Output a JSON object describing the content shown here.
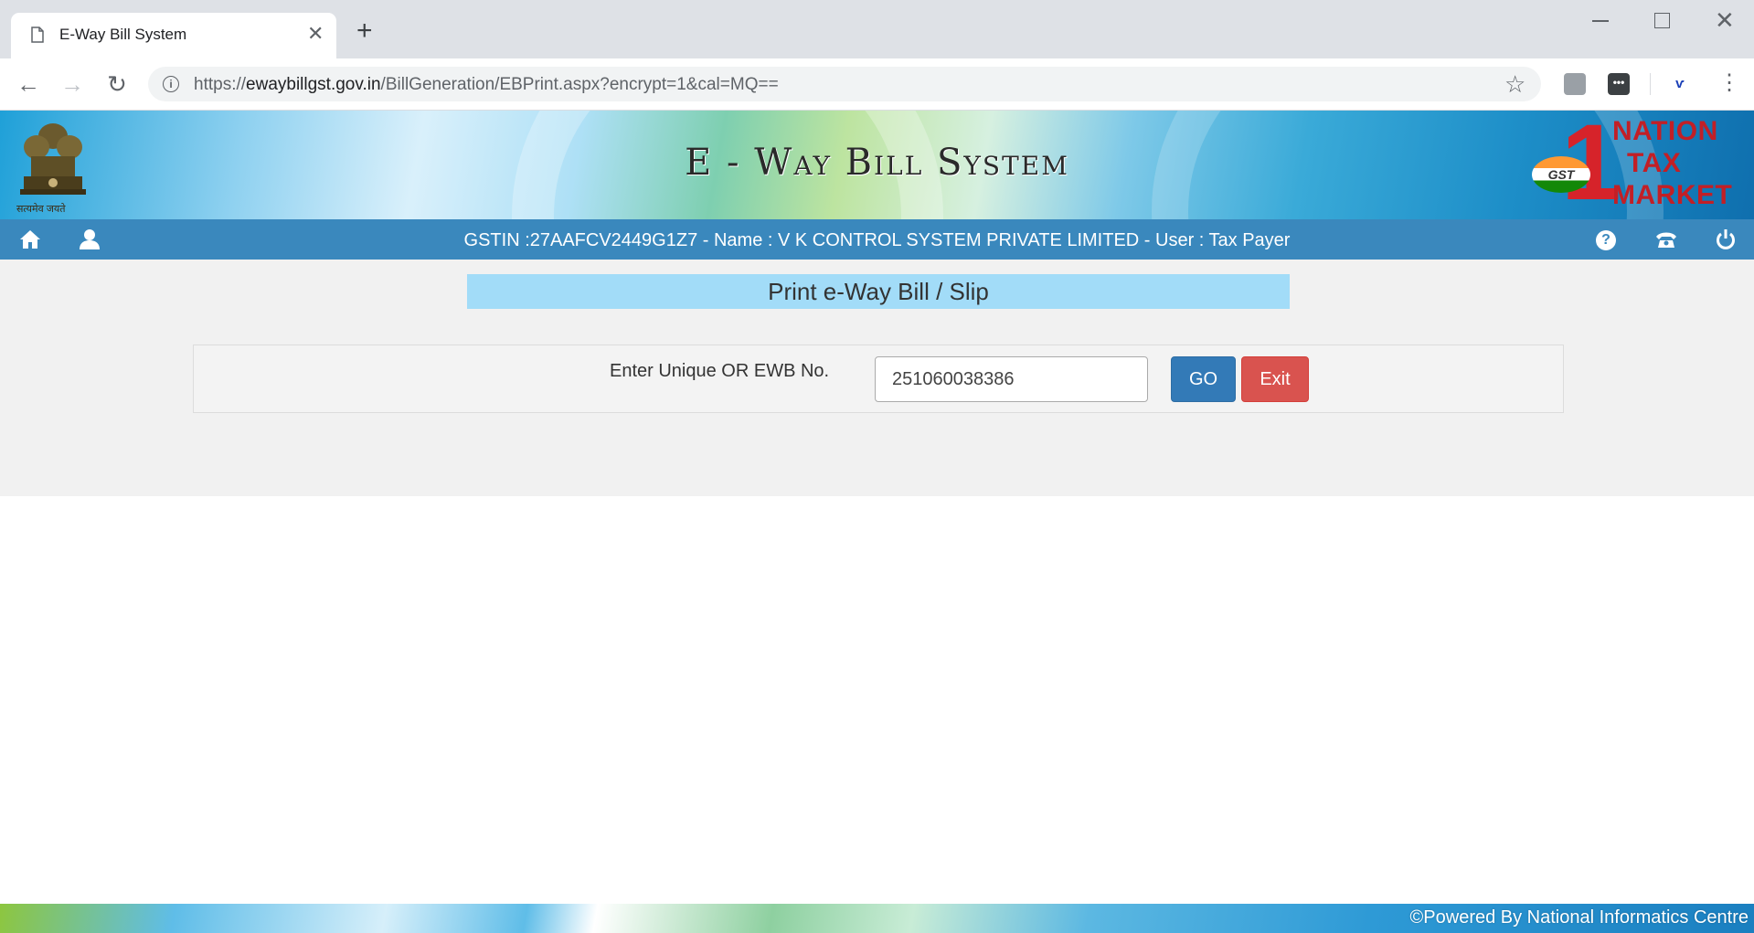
{
  "browser": {
    "tab_title": "E-Way Bill System",
    "url_scheme": "https://",
    "url_domain": "ewaybillgst.gov.in",
    "url_path": "/BillGeneration/EBPrint.aspx?encrypt=1&cal=MQ=="
  },
  "header": {
    "emblem_caption": "सत्यमेव जयते",
    "title": "E - Way Bill System",
    "logo_gst": "GST",
    "logo_lines": [
      "NATION",
      "TAX",
      "MARKET"
    ]
  },
  "navbar": {
    "user_info": "GSTIN :27AAFCV2449G1Z7 - Name : V K CONTROL SYSTEM PRIVATE LIMITED - User : Tax Payer",
    "help_glyph": "?"
  },
  "page": {
    "heading": "Print e-Way Bill / Slip",
    "form_label": "Enter Unique OR EWB No.",
    "ewb_value": "251060038386",
    "go_label": "GO",
    "exit_label": "Exit"
  },
  "footer": {
    "text": "©Powered By National Informatics Centre"
  },
  "colors": {
    "navbar": "#3a88bd",
    "heading_bg": "#a2dcf8",
    "go_button": "#337ab7",
    "exit_button": "#d9534f"
  }
}
